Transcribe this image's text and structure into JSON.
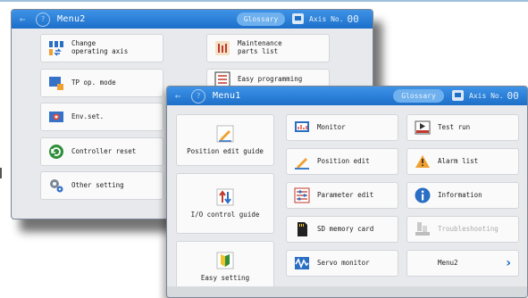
{
  "menu2": {
    "title": "Menu2",
    "glossary": "Glossary",
    "axis_label": "Axis No.",
    "axis_value": "00",
    "buttons": [
      {
        "label": [
          "Change",
          "operating axis"
        ],
        "icon": "change-axis-icon"
      },
      {
        "label": [
          "Maintenance",
          "parts list"
        ],
        "icon": "maintenance-icon"
      },
      {
        "label": [
          "TP op. mode"
        ],
        "icon": "tp-mode-icon"
      },
      {
        "label": [
          "Easy programming"
        ],
        "icon": "easy-programming-icon"
      },
      {
        "label": [
          "Env.set."
        ],
        "icon": "env-set-icon"
      },
      {
        "label": [
          "Controller reset"
        ],
        "icon": "reset-icon"
      },
      {
        "label": [
          "Other setting"
        ],
        "icon": "gear-icon"
      }
    ]
  },
  "menu1": {
    "title": "Menu1",
    "glossary": "Glossary",
    "axis_label": "Axis No.",
    "axis_value": "00",
    "left_buttons": [
      {
        "label": "Position edit guide",
        "icon": "pencil-icon"
      },
      {
        "label": "I/O control guide",
        "icon": "io-arrows-icon"
      },
      {
        "label": "Easy setting",
        "icon": "beginner-mark-icon"
      }
    ],
    "mid_buttons": [
      {
        "label": "Monitor",
        "icon": "monitor-icon"
      },
      {
        "label": "Position edit",
        "icon": "pencil-icon"
      },
      {
        "label": "Parameter edit",
        "icon": "parameter-icon"
      },
      {
        "label": "SD memory card",
        "icon": "sd-card-icon"
      },
      {
        "label": "Servo monitor",
        "icon": "servo-wave-icon"
      }
    ],
    "right_buttons": [
      {
        "label": "Test run",
        "icon": "test-run-icon"
      },
      {
        "label": "Alarm list",
        "icon": "alarm-icon"
      },
      {
        "label": "Information",
        "icon": "info-icon"
      },
      {
        "label": "Troubleshooting",
        "icon": "troubleshooting-icon",
        "disabled": true
      },
      {
        "label": "Menu2",
        "icon": "chevron-right-icon"
      }
    ]
  },
  "colors": {
    "titlebar": "#1d6fc9",
    "accent": "#1d6fc9"
  }
}
